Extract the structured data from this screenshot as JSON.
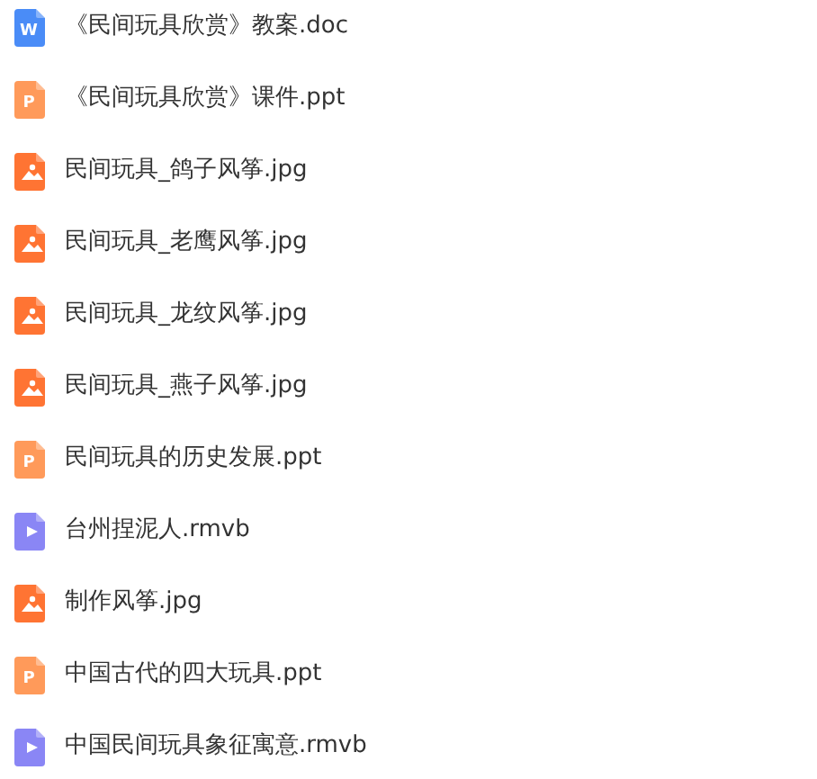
{
  "files": [
    {
      "kind": "doc",
      "badge": "W",
      "name": "《民间玩具欣赏》教案.doc"
    },
    {
      "kind": "ppt",
      "badge": "P",
      "name": "《民间玩具欣赏》课件.ppt"
    },
    {
      "kind": "image",
      "name": "民间玩具_鸽子风筝.jpg"
    },
    {
      "kind": "image",
      "name": "民间玩具_老鹰风筝.jpg"
    },
    {
      "kind": "image",
      "name": "民间玩具_龙纹风筝.jpg"
    },
    {
      "kind": "image",
      "name": "民间玩具_燕子风筝.jpg"
    },
    {
      "kind": "ppt",
      "badge": "P",
      "name": "民间玩具的历史发展.ppt"
    },
    {
      "kind": "video",
      "name": "台州捏泥人.rmvb"
    },
    {
      "kind": "image",
      "name": "制作风筝.jpg"
    },
    {
      "kind": "ppt",
      "badge": "P",
      "name": "中国古代的四大玩具.ppt"
    },
    {
      "kind": "video",
      "name": "中国民间玩具象征寓意.rmvb"
    }
  ]
}
